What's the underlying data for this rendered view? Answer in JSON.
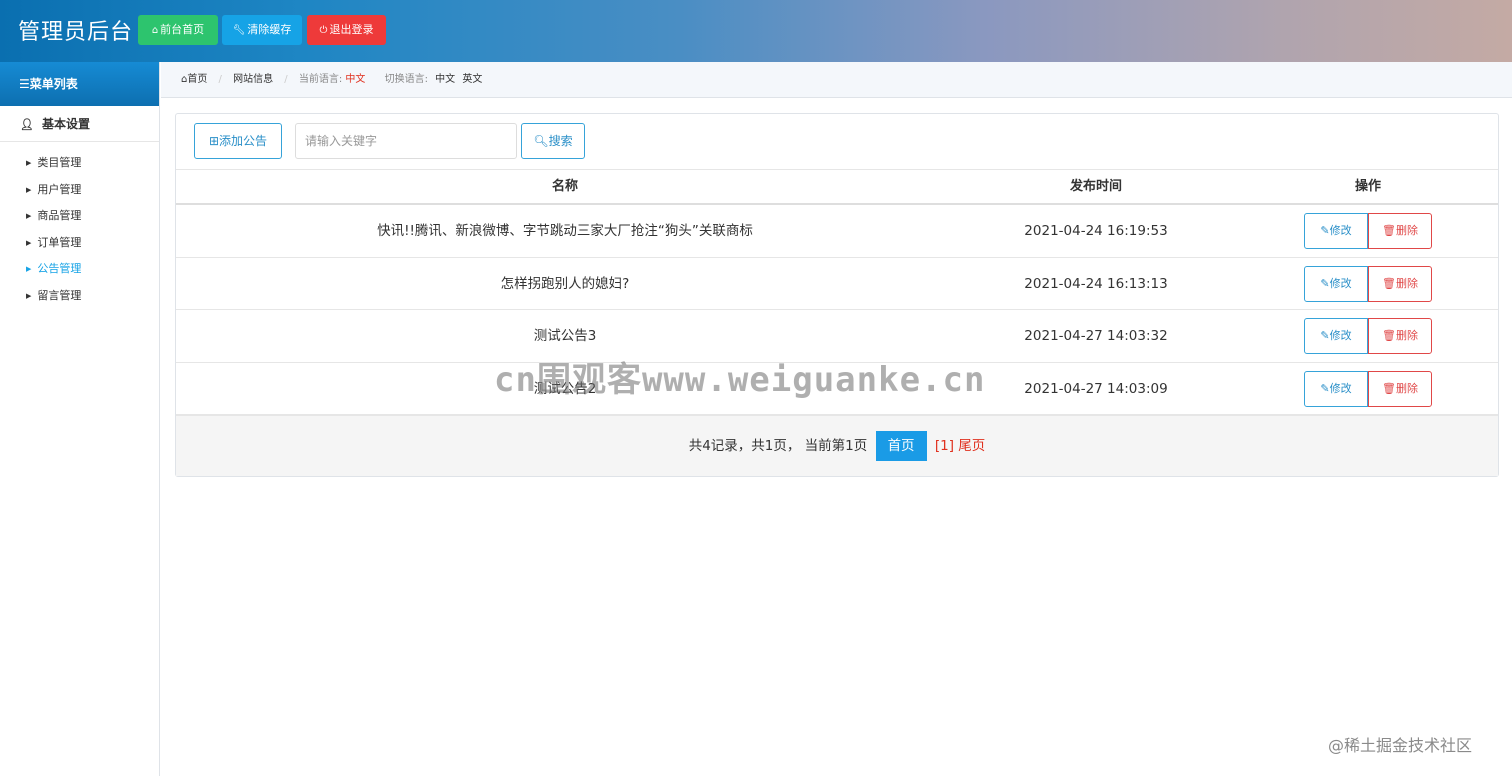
{
  "header": {
    "title": "管理员后台",
    "buttons": {
      "home": "前台首页",
      "clear_cache": "清除缓存",
      "logout": "退出登录"
    }
  },
  "sidebar": {
    "menu_title": "菜单列表",
    "group_label": "基本设置",
    "items": [
      {
        "label": "类目管理"
      },
      {
        "label": "用户管理"
      },
      {
        "label": "商品管理"
      },
      {
        "label": "订单管理"
      },
      {
        "label": "公告管理"
      },
      {
        "label": "留言管理"
      }
    ],
    "active_item": "公告管理"
  },
  "breadcrumb": {
    "home": "首页",
    "site_info": "网站信息",
    "current_lang_label": "当前语言:",
    "current_lang": "中文",
    "switch_lang_label": "切换语言:",
    "lang_options": [
      "中文",
      "英文"
    ]
  },
  "toolbar": {
    "add_label": "添加公告",
    "search_placeholder": "请输入关键字",
    "search_value": "",
    "search_label": "搜索"
  },
  "table": {
    "columns": [
      "名称",
      "发布时间",
      "操作"
    ],
    "rows": [
      {
        "name": "快讯!!腾讯、新浪微博、字节跳动三家大厂抢注“狗头”关联商标",
        "time": "2021-04-24 16:19:53",
        "edit": "修改",
        "delete": "删除"
      },
      {
        "name": "怎样拐跑别人的媳妇?",
        "time": "2021-04-24 16:13:13",
        "edit": "修改",
        "delete": "删除"
      },
      {
        "name": "测试公告3",
        "time": "2021-04-27 14:03:32",
        "edit": "修改",
        "delete": "删除"
      },
      {
        "name": "测试公告2",
        "time": "2021-04-27 14:03:09",
        "edit": "修改",
        "delete": "删除"
      }
    ]
  },
  "pagination": {
    "summary": "共4记录，共1页，  当前第1页",
    "first": "首页",
    "pages": "[1]",
    "last": "尾页"
  },
  "watermarks": {
    "center": "cn围观客www.weiguanke.cn",
    "corner": "@稀土掘金技术社区"
  },
  "colors": {
    "primary": "#16a3e6",
    "success": "#2dc46e",
    "danger": "#ee3a3a",
    "outline_blue": "#36a3d9"
  }
}
